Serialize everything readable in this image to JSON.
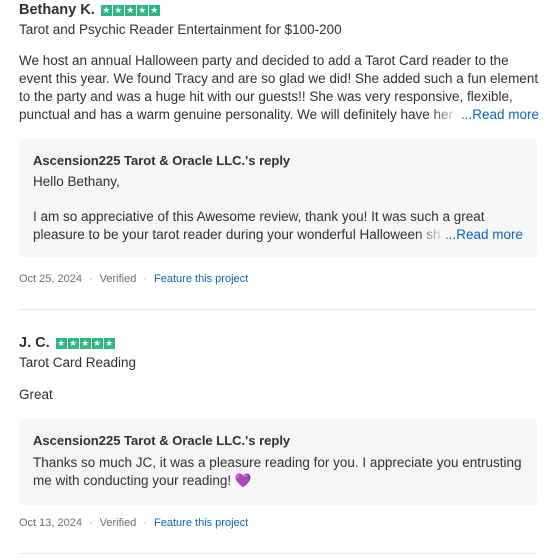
{
  "reviews": [
    {
      "name": "Bethany K.",
      "stars": 5,
      "project": "Tarot and Psychic Reader Entertainment for $100-200",
      "text": "We host an annual Halloween party and decided to add a Tarot Card reader to the event this year. We found Tracy and are so glad we did! She added such a fun element to the party and was a huge hit with our guests!! She was very responsive, flexible, punctual and has a warm genuine personality. We will definitely have her",
      "read_more": "...Read more",
      "reply": {
        "title": "Ascension225 Tarot & Oracle LLC.'s reply",
        "greeting": "Hello Bethany,",
        "text": "I am so appreciative of this Awesome review, thank you! It was such a great pleasure to be your tarot reader during your wonderful Halloween sh",
        "read_more": "...Read more"
      },
      "date": "Oct 25, 2024",
      "verified": "Verified",
      "feature": "Feature this project"
    },
    {
      "name": "J. C.",
      "stars": 5,
      "project": "Tarot Card Reading",
      "text": "Great",
      "reply": {
        "title": "Ascension225 Tarot & Oracle LLC.'s reply",
        "text": "Thanks so much JC, it was a pleasure reading for you. I appreciate you entrusting me with conducting your reading! 💜"
      },
      "date": "Oct 13, 2024",
      "verified": "Verified",
      "feature": "Feature this project"
    }
  ],
  "star_glyph": "★",
  "separator": "·",
  "colors": {
    "star_bg": "#2db783",
    "link": "#0b66c3",
    "reply_bg": "#f6f6f7"
  }
}
